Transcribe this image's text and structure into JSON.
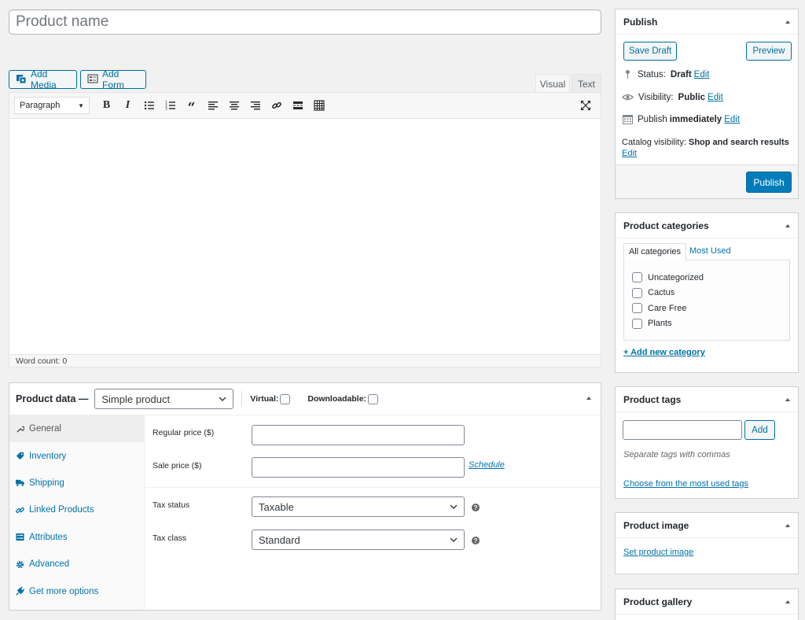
{
  "title": {
    "placeholder": "Product name"
  },
  "media": {
    "add_media": "Add Media",
    "add_form": "Add Form"
  },
  "editor": {
    "tab_visual": "Visual",
    "tab_text": "Text",
    "format": "Paragraph",
    "word_count": "Word count: 0",
    "icons": [
      "bold-icon",
      "italic-icon",
      "bullet-list-icon",
      "numbered-list-icon",
      "blockquote-icon",
      "align-left-icon",
      "align-center-icon",
      "align-right-icon",
      "link-icon",
      "read-more-icon",
      "toolbar-toggle-icon"
    ]
  },
  "product_data": {
    "title": "Product data —",
    "type": "Simple product",
    "virtual_label": "Virtual:",
    "downloadable_label": "Downloadable:",
    "tabs": [
      {
        "label": "General",
        "icon": "wrench-icon"
      },
      {
        "label": "Inventory",
        "icon": "tag-icon"
      },
      {
        "label": "Shipping",
        "icon": "truck-icon"
      },
      {
        "label": "Linked Products",
        "icon": "link-icon"
      },
      {
        "label": "Attributes",
        "icon": "list-icon"
      },
      {
        "label": "Advanced",
        "icon": "gear-icon"
      },
      {
        "label": "Get more options",
        "icon": "plugin-icon"
      }
    ],
    "regular_price_label": "Regular price ($)",
    "sale_price_label": "Sale price ($)",
    "schedule": "Schedule",
    "tax_status_label": "Tax status",
    "tax_status_value": "Taxable",
    "tax_class_label": "Tax class",
    "tax_class_value": "Standard"
  },
  "publish": {
    "title": "Publish",
    "save_draft": "Save Draft",
    "preview": "Preview",
    "status_label": "Status:",
    "status_value": "Draft",
    "visibility_label": "Visibility:",
    "visibility_value": "Public",
    "publish_label": "Publish",
    "publish_value": "immediately",
    "catalog_label": "Catalog visibility:",
    "catalog_value": "Shop and search results",
    "edit": "Edit",
    "publish_button": "Publish"
  },
  "categories": {
    "title": "Product categories",
    "tab_all": "All categories",
    "tab_most_used": "Most Used",
    "items": [
      "Uncategorized",
      "Cactus",
      "Care Free",
      "Plants"
    ],
    "add_new": "+ Add new category"
  },
  "tags": {
    "title": "Product tags",
    "add": "Add",
    "hint": "Separate tags with commas",
    "choose": "Choose from the most used tags"
  },
  "image": {
    "title": "Product image",
    "set": "Set product image"
  },
  "gallery": {
    "title": "Product gallery"
  }
}
